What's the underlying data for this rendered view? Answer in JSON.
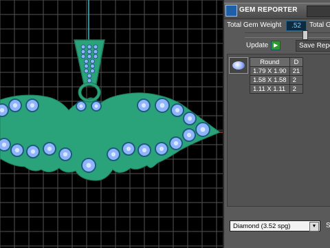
{
  "viewport": {
    "grid_color": "#6a6a6a",
    "body_color": "#2aa37a",
    "gem_color": "#8fb4ff"
  },
  "panel": {
    "title": "GEM REPORTER",
    "total_gem_weight_label": "Total Gem Weight",
    "total_gem_weight_value": ".52",
    "total_label_cut": "Total G",
    "update_label": "Update",
    "save_label": "Save Repo",
    "table": {
      "header": [
        "Round",
        "D"
      ],
      "rows": [
        [
          "1.79 X 1.90",
          "21"
        ],
        [
          "1.58 X 1.58",
          "2"
        ],
        [
          "1.11 X 1.11",
          "2"
        ]
      ]
    },
    "material_select": "Diamond     (3.52 spg)",
    "footer_cut": "S"
  }
}
